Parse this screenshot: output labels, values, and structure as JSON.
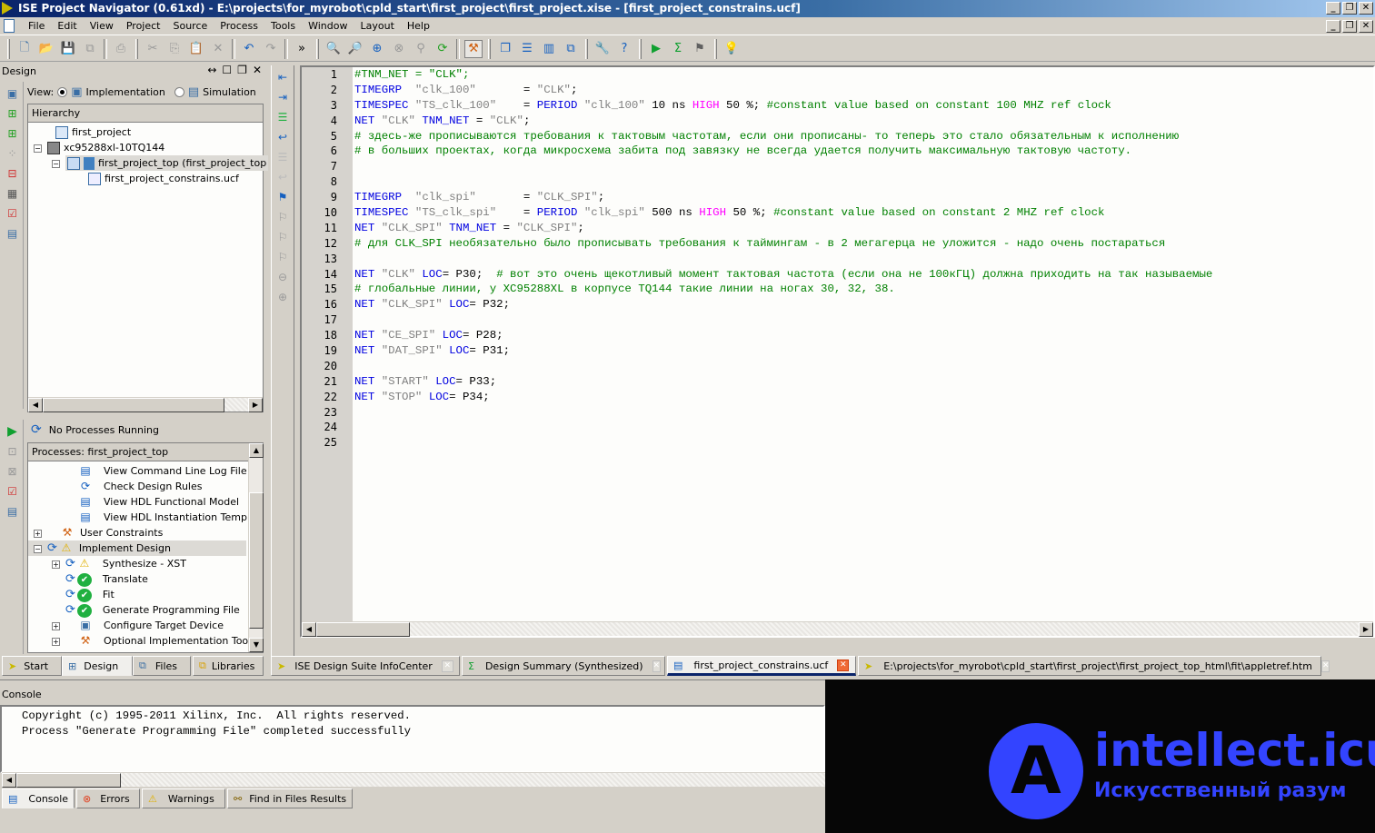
{
  "window": {
    "title": "ISE Project Navigator (0.61xd) - E:\\projects\\for_myrobot\\cpld_start\\first_project\\first_project.xise - [first_project_constrains.ucf]",
    "minimize": "_",
    "restore": "❐",
    "close": "✕"
  },
  "menu": [
    "File",
    "Edit",
    "View",
    "Project",
    "Source",
    "Process",
    "Tools",
    "Window",
    "Layout",
    "Help"
  ],
  "toolbar": {
    "icons": [
      "new-file-icon",
      "open-icon",
      "save-icon",
      "save-all-icon",
      "print-icon",
      "cut-icon",
      "copy-icon",
      "paste-icon",
      "delete-icon",
      "undo-icon",
      "redo-icon",
      "more-icon",
      "zoom-in-icon",
      "zoom-out-icon",
      "zoom-fit-icon",
      "zoom-full-icon",
      "find-icon",
      "refresh-icon",
      "hammer-icon",
      "cascade-icon",
      "tile-horizontal-icon",
      "tile-vertical-icon",
      "window-icon",
      "wrench-icon",
      "help-icon",
      "run-icon",
      "sigma-icon",
      "telescope-icon",
      "lightbulb-icon"
    ],
    "more_label": "»"
  },
  "design_panel": {
    "title": "Design",
    "header_icons": [
      "↔",
      "☐",
      "❐",
      "✕"
    ],
    "view_label": "View:",
    "view_options": [
      {
        "label": "Implementation",
        "selected": true
      },
      {
        "label": "Simulation",
        "selected": false
      }
    ],
    "hierarchy_label": "Hierarchy",
    "hierarchy": [
      {
        "label": "first_project",
        "indent": 0
      },
      {
        "label": "xc95288xl-10TQ144",
        "indent": 0
      },
      {
        "label": "first_project_top (first_project_top",
        "indent": 1,
        "selected": true
      },
      {
        "label": "first_project_constrains.ucf",
        "indent": 2
      }
    ]
  },
  "processes_panel": {
    "status": "No Processes Running",
    "header": "Processes: first_project_top",
    "items": [
      {
        "label": "View Command Line Log File",
        "icon": "document-icon"
      },
      {
        "label": "Check Design Rules",
        "icon": "sync-icon"
      },
      {
        "label": "View HDL Functional Model",
        "icon": "document-icon"
      },
      {
        "label": "View HDL Instantiation Temp...",
        "icon": "document-icon"
      },
      {
        "label": "User Constraints",
        "icon": "tools-icon"
      },
      {
        "label": "Implement Design",
        "icon": "warning-icon",
        "selected": true
      },
      {
        "label": "Synthesize - XST",
        "icon": "warning-icon"
      },
      {
        "label": "Translate",
        "icon": "check-icon"
      },
      {
        "label": "Fit",
        "icon": "check-icon"
      },
      {
        "label": "Generate Programming File",
        "icon": "check-icon"
      },
      {
        "label": "Configure Target Device",
        "icon": "device-icon"
      },
      {
        "label": "Optional Implementation Tools",
        "icon": "tools-icon"
      }
    ]
  },
  "left_tabs": [
    "Start",
    "Design",
    "Files",
    "Libraries"
  ],
  "editor": {
    "line_numbers": [
      "1",
      "2",
      "3",
      "4",
      "5",
      "6",
      "7",
      "8",
      "9",
      "10",
      "11",
      "12",
      "13",
      "14",
      "15",
      "16",
      "17",
      "18",
      "19",
      "20",
      "21",
      "22",
      "23",
      "24",
      "25"
    ],
    "lines": [
      [
        {
          "t": "#TNM_NET = \"CLK\";",
          "c": "cm"
        }
      ],
      [
        {
          "t": "TIMEGRP",
          "c": "kw"
        },
        {
          "t": "  \"clk_100\"",
          "c": "str"
        },
        {
          "t": "       = ",
          "c": ""
        },
        {
          "t": "\"CLK\"",
          "c": "str"
        },
        {
          "t": ";",
          "c": ""
        }
      ],
      [
        {
          "t": "TIMESPEC",
          "c": "kw"
        },
        {
          "t": " \"TS_clk_100\"",
          "c": "str"
        },
        {
          "t": "    = ",
          "c": ""
        },
        {
          "t": "PERIOD",
          "c": "kw"
        },
        {
          "t": " \"clk_100\"",
          "c": "str"
        },
        {
          "t": " 10 ns ",
          "c": ""
        },
        {
          "t": "HIGH",
          "c": "hi"
        },
        {
          "t": " 50 %; ",
          "c": ""
        },
        {
          "t": "#constant value based on constant 100 MHZ ref clock",
          "c": "cm"
        }
      ],
      [
        {
          "t": "NET",
          "c": "kw"
        },
        {
          "t": " \"CLK\" ",
          "c": "str"
        },
        {
          "t": "TNM_NET",
          "c": "kw"
        },
        {
          "t": " = ",
          "c": ""
        },
        {
          "t": "\"CLK\"",
          "c": "str"
        },
        {
          "t": ";",
          "c": ""
        }
      ],
      [
        {
          "t": "# здесь-же прописываются требования к тактовым частотам, если они прописаны- то теперь это стало обязательным к исполнению",
          "c": "cm"
        }
      ],
      [
        {
          "t": "# в больших проектах, когда микросхема забита под завязку не всегда удается получить максимальную тактовую частоту.",
          "c": "cm"
        }
      ],
      [],
      [],
      [
        {
          "t": "TIMEGRP",
          "c": "kw"
        },
        {
          "t": "  \"clk_spi\"",
          "c": "str"
        },
        {
          "t": "       = ",
          "c": ""
        },
        {
          "t": "\"CLK_SPI\"",
          "c": "str"
        },
        {
          "t": ";",
          "c": ""
        }
      ],
      [
        {
          "t": "TIMESPEC",
          "c": "kw"
        },
        {
          "t": " \"TS_clk_spi\"",
          "c": "str"
        },
        {
          "t": "    = ",
          "c": ""
        },
        {
          "t": "PERIOD",
          "c": "kw"
        },
        {
          "t": " \"clk_spi\"",
          "c": "str"
        },
        {
          "t": " 500 ns ",
          "c": ""
        },
        {
          "t": "HIGH",
          "c": "hi"
        },
        {
          "t": " 50 %; ",
          "c": ""
        },
        {
          "t": "#constant value based on constant 2 MHZ ref clock",
          "c": "cm"
        }
      ],
      [
        {
          "t": "NET",
          "c": "kw"
        },
        {
          "t": " \"CLK_SPI\" ",
          "c": "str"
        },
        {
          "t": "TNM_NET",
          "c": "kw"
        },
        {
          "t": " = ",
          "c": ""
        },
        {
          "t": "\"CLK_SPI\"",
          "c": "str"
        },
        {
          "t": ";",
          "c": ""
        }
      ],
      [
        {
          "t": "# для CLK_SPI необязательно было прописывать требования к таймингам - в 2 мегагерца не уложится - надо очень постараться",
          "c": "cm"
        }
      ],
      [],
      [
        {
          "t": "NET",
          "c": "kw"
        },
        {
          "t": " \"CLK\" ",
          "c": "str"
        },
        {
          "t": "LOC",
          "c": "kw"
        },
        {
          "t": "= P30;  ",
          "c": ""
        },
        {
          "t": "# вот это очень щекотливый момент тактовая частота (если она не 100кГЦ) должна приходить на так называемые",
          "c": "cm"
        }
      ],
      [
        {
          "t": "# глобальные линии, у XC95288XL в корпусе TQ144 такие линии на ногах 30, 32, 38.",
          "c": "cm"
        }
      ],
      [
        {
          "t": "NET",
          "c": "kw"
        },
        {
          "t": " \"CLK_SPI\" ",
          "c": "str"
        },
        {
          "t": "LOC",
          "c": "kw"
        },
        {
          "t": "= P32;",
          "c": ""
        }
      ],
      [],
      [
        {
          "t": "NET",
          "c": "kw"
        },
        {
          "t": " \"CE_SPI\" ",
          "c": "str"
        },
        {
          "t": "LOC",
          "c": "kw"
        },
        {
          "t": "= P28;",
          "c": ""
        }
      ],
      [
        {
          "t": "NET",
          "c": "kw"
        },
        {
          "t": " \"DAT_SPI\" ",
          "c": "str"
        },
        {
          "t": "LOC",
          "c": "kw"
        },
        {
          "t": "= P31;",
          "c": ""
        }
      ],
      [],
      [
        {
          "t": "NET",
          "c": "kw"
        },
        {
          "t": " \"START\" ",
          "c": "str"
        },
        {
          "t": "LOC",
          "c": "kw"
        },
        {
          "t": "= P33;",
          "c": ""
        }
      ],
      [
        {
          "t": "NET",
          "c": "kw"
        },
        {
          "t": " \"STOP\" ",
          "c": "str"
        },
        {
          "t": "LOC",
          "c": "kw"
        },
        {
          "t": "= P34;",
          "c": ""
        }
      ],
      [],
      [],
      []
    ]
  },
  "doc_tabs": [
    {
      "label": "ISE Design Suite InfoCenter",
      "icon": "ise-icon",
      "active": false
    },
    {
      "label": "Design Summary (Synthesized)",
      "icon": "sigma-icon",
      "active": false
    },
    {
      "label": "first_project_constrains.ucf",
      "icon": "document-icon",
      "active": true
    },
    {
      "label": "E:\\projects\\for_myrobot\\cpld_start\\first_project\\first_project_top_html\\fit\\appletref.htm",
      "icon": "ise-icon",
      "active": false
    }
  ],
  "console": {
    "title": "Console",
    "lines": [
      "Copyright (c) 1995-2011 Xilinx, Inc.  All rights reserved.",
      "",
      "Process \"Generate Programming File\" completed successfully"
    ],
    "tabs": [
      "Console",
      "Errors",
      "Warnings",
      "Find in Files Results"
    ]
  },
  "watermark": {
    "brand": "intellect.icu",
    "tagline": "Искусственный разум",
    "color": "#3344ff"
  }
}
